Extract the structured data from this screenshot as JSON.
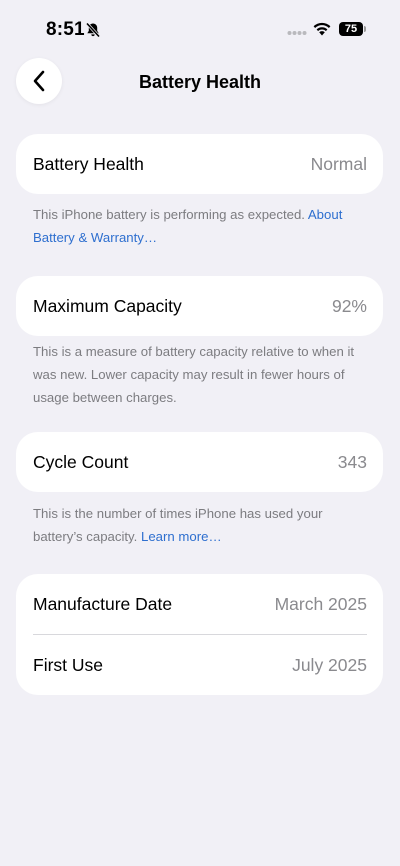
{
  "status_bar": {
    "time": "8:51",
    "battery_level": "75",
    "icons": [
      "bell-slash-icon",
      "signal-dots-icon",
      "wifi-icon",
      "battery-icon"
    ]
  },
  "nav": {
    "back_icon": "chevron-left-icon",
    "title": "Battery Health"
  },
  "sections": {
    "health": {
      "label": "Battery Health",
      "value": "Normal",
      "footnote": "This iPhone battery is performing as expected. ",
      "link": "About Battery & Warranty…"
    },
    "capacity": {
      "label": "Maximum Capacity",
      "value": "92%",
      "footnote": "This is a measure of battery capacity relative to when it was new. Lower capacity may result in fewer hours of usage between charges."
    },
    "cycles": {
      "label": "Cycle Count",
      "value": "343",
      "footnote": "This is the number of times iPhone has used your battery’s capacity. ",
      "link": "Learn more…"
    },
    "dates": {
      "manufacture_label": "Manufacture Date",
      "manufacture_value": "March 2025",
      "first_use_label": "First Use",
      "first_use_value": "July 2025"
    }
  },
  "colors": {
    "background": "#f1f0f6",
    "card": "#ffffff",
    "link": "#2e6fcf",
    "secondary_text": "#8a8a8e"
  }
}
